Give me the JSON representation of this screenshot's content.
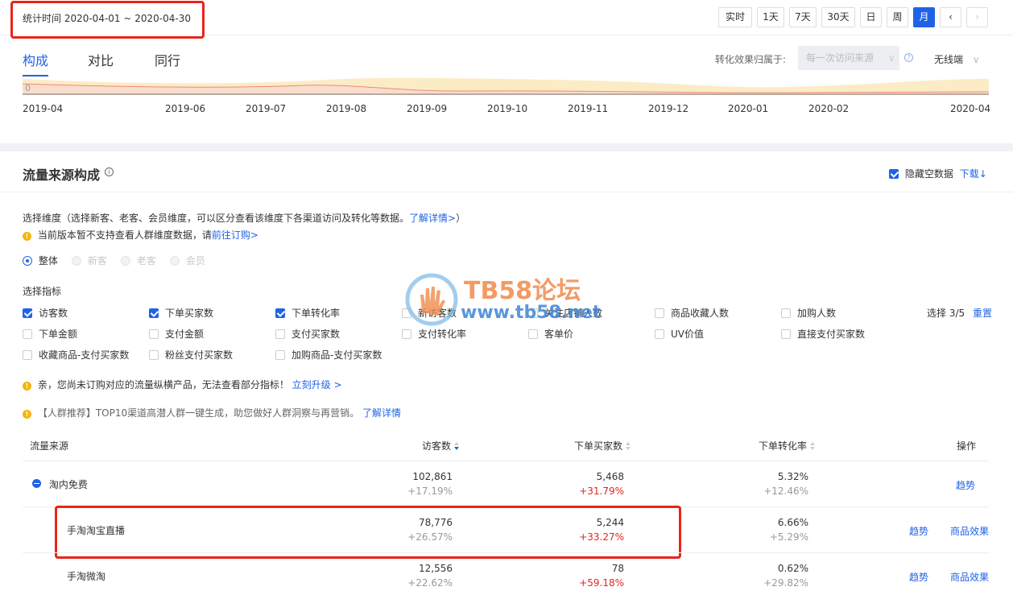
{
  "header": {
    "stat_time": "统计时间 2020-04-01 ~ 2020-04-30",
    "period_buttons": [
      "实时",
      "1天",
      "7天",
      "30天",
      "日",
      "周",
      "月"
    ],
    "active_period": "月"
  },
  "tabs": [
    "构成",
    "对比",
    "同行"
  ],
  "active_tab": "构成",
  "attribution": {
    "label": "转化效果归属于:",
    "value": "每一次访问来源",
    "device": "无线端"
  },
  "chart": {
    "y_zero": "0",
    "x_ticks": [
      "2019-04",
      "2019-06",
      "2019-07",
      "2019-08",
      "2019-09",
      "2019-10",
      "2019-11",
      "2019-12",
      "2020-01",
      "2020-02",
      "2020-04"
    ]
  },
  "section": {
    "title": "流量来源构成",
    "hide_empty": "隐藏空数据",
    "download": "下载"
  },
  "dimension": {
    "desc": "选择维度（选择新客、老客、会员维度，可以区分查看该维度下各渠道访问及转化等数据。",
    "desc_link": "了解详情>",
    "desc_end": "）",
    "notice": "当前版本暂不支持查看人群维度数据，请",
    "notice_link": "前往订购>",
    "options": [
      "整体",
      "新客",
      "老客",
      "会员"
    ]
  },
  "metrics": {
    "label": "选择指标",
    "selected_count": "选择 3/5",
    "reset": "重置",
    "items": [
      {
        "label": "访客数",
        "checked": true
      },
      {
        "label": "下单买家数",
        "checked": true
      },
      {
        "label": "下单转化率",
        "checked": true
      },
      {
        "label": "新访客数",
        "checked": false
      },
      {
        "label": "关注店铺人数",
        "checked": false
      },
      {
        "label": "商品收藏人数",
        "checked": false
      },
      {
        "label": "加购人数",
        "checked": false
      },
      {
        "label": "下单金额",
        "checked": false
      },
      {
        "label": "支付金额",
        "checked": false
      },
      {
        "label": "支付买家数",
        "checked": false
      },
      {
        "label": "支付转化率",
        "checked": false
      },
      {
        "label": "客单价",
        "checked": false
      },
      {
        "label": "UV价值",
        "checked": false
      },
      {
        "label": "直接支付买家数",
        "checked": false
      },
      {
        "label": "收藏商品-支付买家数",
        "checked": false
      },
      {
        "label": "粉丝支付买家数",
        "checked": false
      },
      {
        "label": "加购商品-支付买家数",
        "checked": false
      }
    ]
  },
  "notices": {
    "upgrade": "亲，您尚未订购对应的流量纵横产品，无法查看部分指标！",
    "upgrade_link": "立刻升级 >",
    "crowd": "【人群推荐】TOP10渠道高潜人群一键生成，助您做好人群洞察与再营销。",
    "crowd_link": "了解详情"
  },
  "table": {
    "headers": [
      "流量来源",
      "访客数",
      "下单买家数",
      "下单转化率",
      "操作"
    ],
    "rows": [
      {
        "name": "淘内免费",
        "visitors": "102,861",
        "visitors_change": "+17.19%",
        "buyers": "5,468",
        "buyers_change": "+31.79%",
        "rate": "5.32%",
        "rate_change": "+12.46%",
        "actions": [
          "趋势"
        ]
      },
      {
        "name": "手淘淘宝直播",
        "visitors": "78,776",
        "visitors_change": "+26.57%",
        "buyers": "5,244",
        "buyers_change": "+33.27%",
        "rate": "6.66%",
        "rate_change": "+5.29%",
        "actions": [
          "趋势",
          "商品效果"
        ]
      },
      {
        "name": "手淘微淘",
        "visitors": "12,556",
        "visitors_change": "+22.62%",
        "buyers": "78",
        "buyers_change": "+59.18%",
        "rate": "0.62%",
        "rate_change": "+29.82%",
        "actions": [
          "趋势",
          "商品效果"
        ]
      }
    ]
  },
  "watermark": {
    "line1": "TB58论坛",
    "line2": "www.tb58.net"
  },
  "colors": {
    "accent": "#2062e6",
    "highlight_box": "#e8241b",
    "positive_red": "#e8241b"
  }
}
